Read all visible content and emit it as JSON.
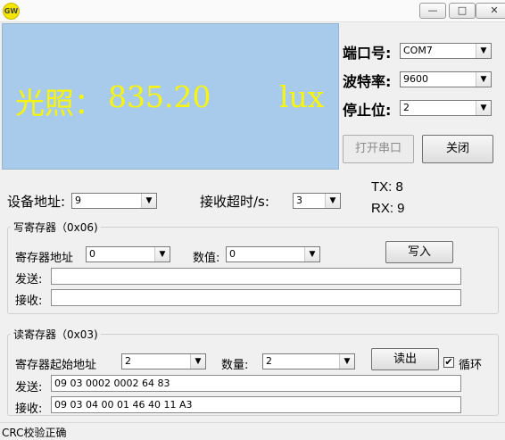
{
  "window": {
    "app_icon_text": "GW",
    "min": "—",
    "max": "□",
    "close": "✕"
  },
  "display": {
    "label": "光照：",
    "value": "835.20",
    "unit": "lux"
  },
  "serial": {
    "port_label": "端口号:",
    "port_value": "COM7",
    "baud_label": "波特率:",
    "baud_value": "9600",
    "stop_label": "停止位:",
    "stop_value": "2",
    "open_button": "打开串口",
    "close_button": "关闭"
  },
  "device": {
    "address_label": "设备地址:",
    "address_value": "9",
    "timeout_label": "接收超时/s:",
    "timeout_value": "3",
    "tx_label": "TX: 8",
    "rx_label": "RX: 9"
  },
  "write_group": {
    "title": "写寄存器（0x06)",
    "reg_addr_label": "寄存器地址",
    "reg_addr_value": "0",
    "value_label": "数值:",
    "value_value": "0",
    "write_button": "写入",
    "send_label": "发送:",
    "send_value": "",
    "recv_label": "接收:",
    "recv_value": ""
  },
  "read_group": {
    "title": "读寄存器（0x03)",
    "start_addr_label": "寄存器起始地址",
    "start_addr_value": "2",
    "count_label": "数量:",
    "count_value": "2",
    "read_button": "读出",
    "loop_label": "循环",
    "loop_checked": "✔",
    "send_label": "发送:",
    "send_value": "09 03 0002 0002 64 83",
    "recv_label": "接收:",
    "recv_value": "09 03 04 00 01 46 40 11 A3"
  },
  "status": {
    "text": "CRC校验正确"
  }
}
